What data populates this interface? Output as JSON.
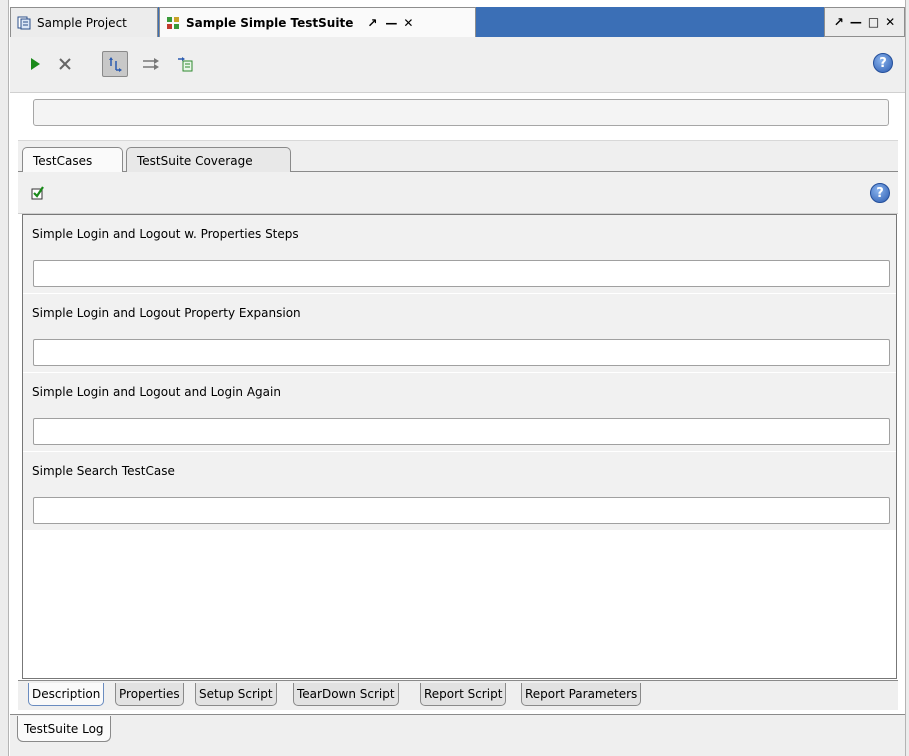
{
  "window": {
    "tabs": [
      {
        "label": "Sample Project",
        "icon": "project-icon"
      },
      {
        "label": "Sample Simple TestSuite",
        "icon": "testsuite-icon"
      }
    ],
    "tab_ctrls": [
      "↗",
      "—",
      "✕"
    ],
    "window_ctrls": [
      "↗",
      "—",
      "□",
      "✕"
    ]
  },
  "toolbar": {
    "buttons": [
      "run-icon",
      "cancel-icon",
      "sequential-icon",
      "parallel-icon",
      "export-icon"
    ],
    "help": "?"
  },
  "progress": {
    "value": 0
  },
  "suite_tabs": [
    "TestCases",
    "TestSuite Coverage"
  ],
  "inner_toolbar": {
    "help": "?"
  },
  "test_cases": [
    {
      "name": "Simple Login and Logout w. Properties Steps",
      "progress": 0
    },
    {
      "name": "Simple Login and Logout Property Expansion",
      "progress": 0
    },
    {
      "name": "Simple Login and Logout and Login Again",
      "progress": 0
    },
    {
      "name": "Simple Search TestCase",
      "progress": 0
    }
  ],
  "bottom_tabs": [
    "Description",
    "Properties",
    "Setup Script",
    "TearDown Script",
    "Report Script",
    "Report Parameters"
  ],
  "log_tab": "TestSuite Log",
  "colors": {
    "title_bar": "#3b6fb6",
    "run_green": "#1a8a1a",
    "help_blue": "#2b5bb0"
  }
}
